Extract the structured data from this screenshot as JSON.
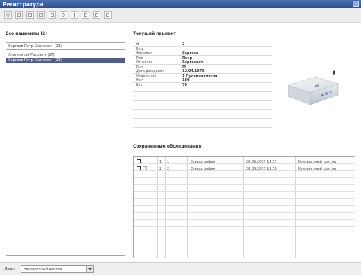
{
  "window": {
    "title": "Регистратура"
  },
  "patients": {
    "title": "Все пациенты (2)",
    "search_value": "Сергеев Петр Сергеевич (28)",
    "items": [
      {
        "label": "Анонимный Пациент (27)",
        "selected": false
      },
      {
        "label": "Сергеев Петр Сергеевич (28)",
        "selected": true
      }
    ]
  },
  "current_patient": {
    "title": "Текущий пациент",
    "fields": [
      {
        "key": "id",
        "value": "2"
      },
      {
        "key": "Код",
        "value": ""
      },
      {
        "key": "Фамилия",
        "value": "Сергеев"
      },
      {
        "key": "Имя",
        "value": "Петр"
      },
      {
        "key": "Отчество",
        "value": "Сергеевич"
      },
      {
        "key": "Пол",
        "value": "М"
      },
      {
        "key": "Дата рождения",
        "value": "12.04.1979"
      },
      {
        "key": "Отделение",
        "value": "1 Пульмонология"
      },
      {
        "key": "Рост",
        "value": "180"
      },
      {
        "key": "Вес",
        "value": "70"
      }
    ]
  },
  "observations": {
    "title": "Сохраненные обследования",
    "rows": [
      {
        "col1": "1",
        "col2": "1",
        "type": "Спирография",
        "date": "28.05.2007 13:37",
        "doctor": "Неизвестный доктор"
      },
      {
        "col1": "2",
        "col2": "2",
        "type": "Спирография",
        "date": "28.05.2007 13:38",
        "doctor": "Неизвестный доктор"
      }
    ]
  },
  "statusbar": {
    "label": "Врач",
    "doctor_value": "Неизвестный доктор"
  }
}
